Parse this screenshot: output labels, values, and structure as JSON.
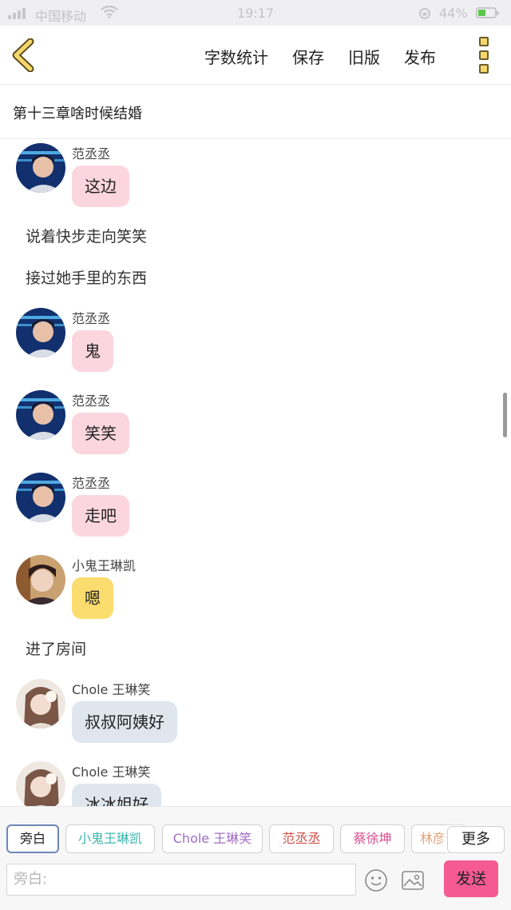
{
  "status_bar": {
    "carrier": "中国移动",
    "time": "19:17",
    "battery": "44%"
  },
  "nav": {
    "actions": [
      "字数统计",
      "保存",
      "旧版",
      "发布"
    ]
  },
  "chapter_title": "第十三章啥时候结婚",
  "messages": [
    {
      "kind": "chat",
      "sender": "范丞丞",
      "text": "这边",
      "bubble_color": "#fcd6df",
      "avatar": "avatar-fan"
    },
    {
      "kind": "narration",
      "text": "说着快步走向笑笑"
    },
    {
      "kind": "narration",
      "text": "接过她手里的东西"
    },
    {
      "kind": "chat",
      "sender": "范丞丞",
      "text": "鬼",
      "bubble_color": "#fcd6df",
      "avatar": "avatar-fan"
    },
    {
      "kind": "chat",
      "sender": "范丞丞",
      "text": "笑笑",
      "bubble_color": "#fcd6df",
      "avatar": "avatar-fan"
    },
    {
      "kind": "chat",
      "sender": "范丞丞",
      "text": "走吧",
      "bubble_color": "#fcd6df",
      "avatar": "avatar-fan"
    },
    {
      "kind": "chat",
      "sender": "小鬼王琳凯",
      "text": "嗯",
      "bubble_color": "#fbdc6e",
      "avatar": "avatar-wang"
    },
    {
      "kind": "narration",
      "text": "进了房间"
    },
    {
      "kind": "chat",
      "sender": "Chole 王琳笑",
      "text": "叔叔阿姨好",
      "bubble_color": "#dfe6ee",
      "avatar": "avatar-chole"
    },
    {
      "kind": "chat",
      "sender": "Chole 王琳笑",
      "text": "冰冰姐好",
      "bubble_color": "#dfe6ee",
      "avatar": "avatar-chole"
    }
  ],
  "characters": [
    {
      "label": "旁白",
      "color": "#222222",
      "selected": true
    },
    {
      "label": "小鬼王琳凯",
      "color": "#3cb6ad"
    },
    {
      "label": "Chole 王琳笑",
      "color": "#a06cc4"
    },
    {
      "label": "范丞丞",
      "color": "#d2504a"
    },
    {
      "label": "蔡徐坤",
      "color": "#d94f8f"
    },
    {
      "label": "林彦俊",
      "color": "#e2a37a"
    }
  ],
  "more_label": "更多",
  "input": {
    "placeholder": "旁白:"
  },
  "icons": {
    "back": "chevron-left-icon",
    "menu": "vertical-dots-icon",
    "emoji": "smiley-icon",
    "image": "image-icon"
  },
  "send_label": "发送",
  "colors": {
    "accent_send": "#f65a92",
    "nav_icon": "#f3d76b"
  }
}
